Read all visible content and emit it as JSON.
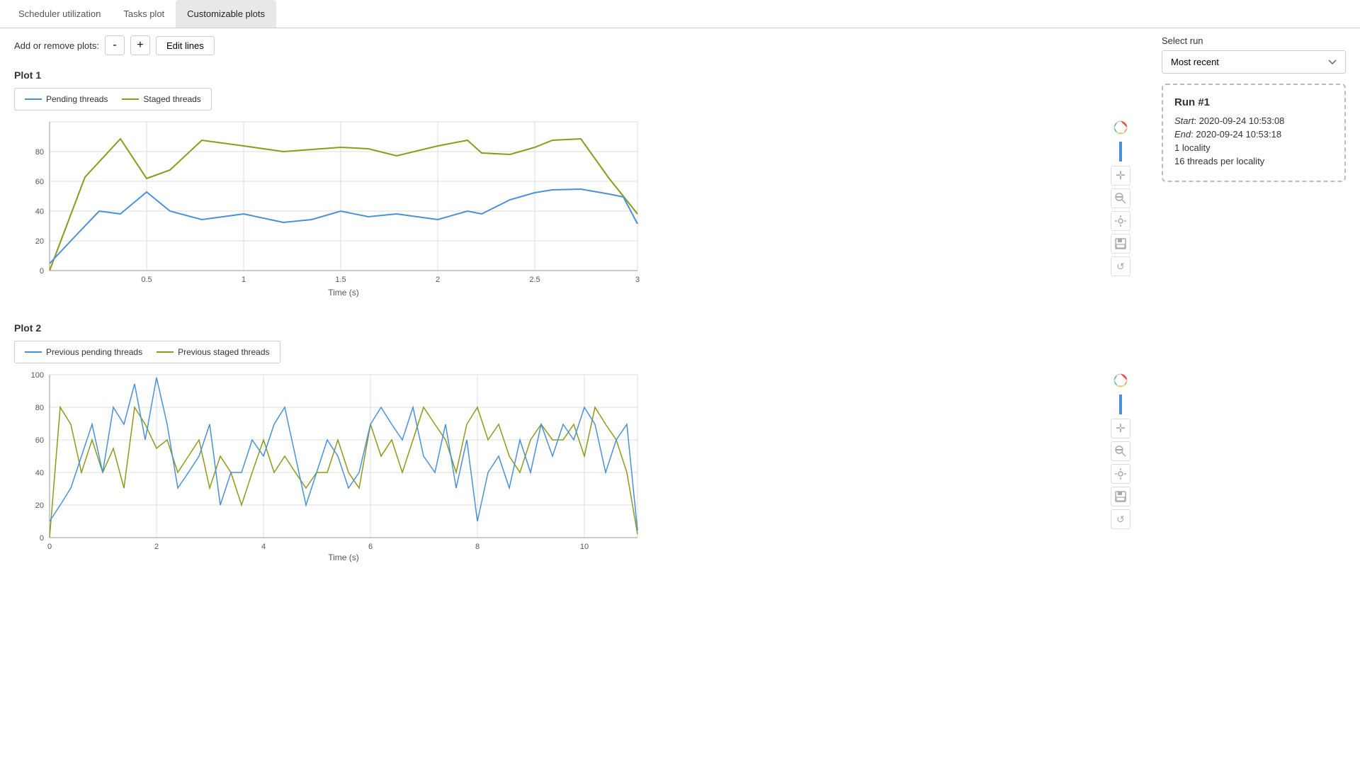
{
  "tabs": [
    {
      "label": "Scheduler utilization",
      "active": false
    },
    {
      "label": "Tasks plot",
      "active": false
    },
    {
      "label": "Customizable plots",
      "active": true
    }
  ],
  "toolbar": {
    "add_remove_label": "Add or remove plots:",
    "remove_label": "-",
    "add_label": "+",
    "edit_lines_label": "Edit lines"
  },
  "select_run": {
    "label": "Select run",
    "selected": "Most recent",
    "options": [
      "Most recent"
    ]
  },
  "run_info": {
    "title": "Run #1",
    "start_label": "Start",
    "start_value": "2020-09-24 10:53:08",
    "end_label": "End",
    "end_value": "2020-09-24 10:53:18",
    "locality": "1 locality",
    "threads": "16 threads per locality"
  },
  "plot1": {
    "title": "Plot 1",
    "legend": [
      {
        "label": "Pending threads",
        "color": "#4a90d9"
      },
      {
        "label": "Staged threads",
        "color": "#8b9a1a"
      }
    ],
    "y_axis_label": "",
    "x_axis_label": "Time (s)",
    "x_ticks": [
      "0.5",
      "1",
      "1.5",
      "2",
      "2.5",
      "3"
    ],
    "y_ticks": [
      "0",
      "20",
      "40",
      "60",
      "80"
    ]
  },
  "plot2": {
    "title": "Plot 2",
    "legend": [
      {
        "label": "Previous pending threads",
        "color": "#4a90d9"
      },
      {
        "label": "Previous staged threads",
        "color": "#8b9a1a"
      }
    ],
    "x_axis_label": "Time (s)",
    "x_ticks": [
      "0",
      "2",
      "4",
      "6",
      "8",
      "10"
    ],
    "y_ticks": [
      "0",
      "20",
      "40",
      "60",
      "80",
      "100"
    ]
  },
  "icons": {
    "color_wheel": "⚙",
    "pan": "✛",
    "zoom": "🔍",
    "reset": "↺",
    "save": "💾",
    "tools": "⚙"
  }
}
